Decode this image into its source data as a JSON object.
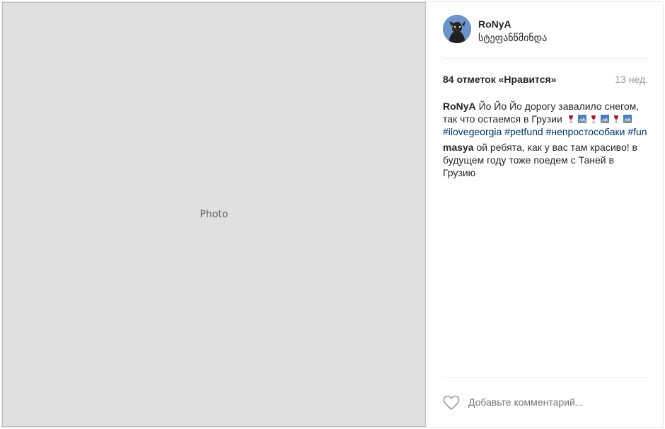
{
  "post": {
    "photo_alt": "Photo",
    "header": {
      "username": "RoNyA",
      "location": "სტეფანწმინდა"
    },
    "stats": {
      "likes": "84 отметок «Нравится»",
      "age": "13 нед."
    },
    "caption": {
      "author": "RoNyA",
      "text": "Йо Йо Йо дорогу завалило снегом, так что остаемся в Грузии",
      "emojis": [
        "wine-glass-emoji",
        "mountain-emoji",
        "wine-glass-emoji",
        "mountain-emoji",
        "wine-glass-emoji",
        "mountain-emoji"
      ],
      "hashtags": [
        "#ilovegeorgia",
        "#petfund",
        "#непростособаки",
        "#fun"
      ]
    },
    "comments": [
      {
        "author": "masya",
        "text": "ой ребята, как у вас там красиво! в будущем году тоже поедем с Таней в Грузию"
      }
    ],
    "footer": {
      "comment_placeholder": "Добавьте комментарий..."
    },
    "colors": {
      "hashtag": "#003569",
      "muted": "#999999",
      "text": "#262626",
      "border": "#efefef"
    }
  }
}
